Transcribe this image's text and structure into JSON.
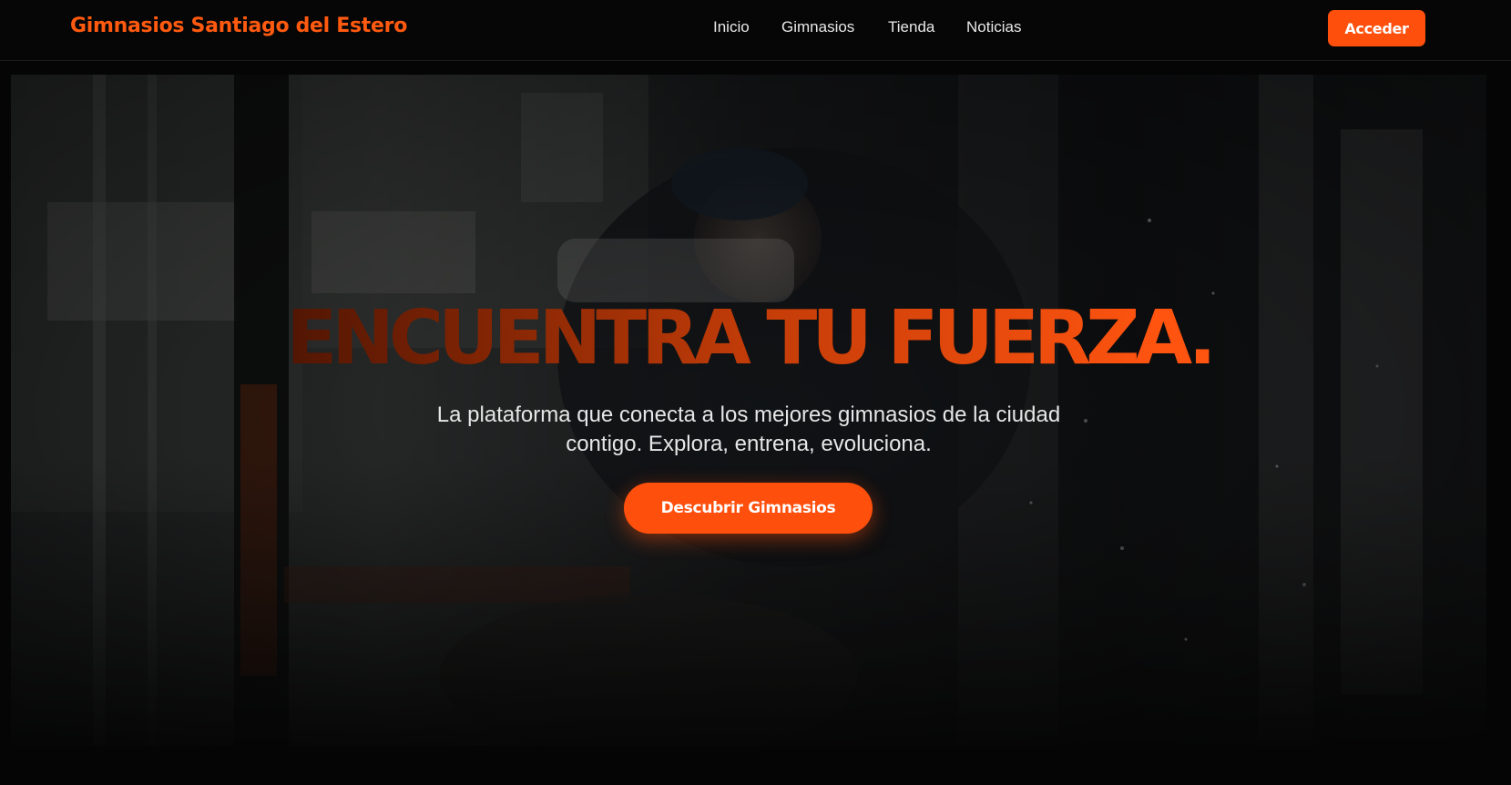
{
  "header": {
    "brand": "Gimnasios Santiago del Estero",
    "nav": [
      "Inicio",
      "Gimnasios",
      "Tienda",
      "Noticias"
    ],
    "login_label": "Acceder"
  },
  "hero": {
    "title": "ENCUENTRA TU FUERZA.",
    "subtitle": "La plataforma que conecta a los mejores gimnasios de la ciudad contigo. Explora, entrena, evoluciona.",
    "cta_label": "Descubrir Gimnasios",
    "background_image": "gym-weightlifter-photo"
  },
  "colors": {
    "accent": "#ff5a10",
    "button": "#ff4f0c",
    "page_background": "#050505",
    "nav_text": "#e8e8e8"
  }
}
